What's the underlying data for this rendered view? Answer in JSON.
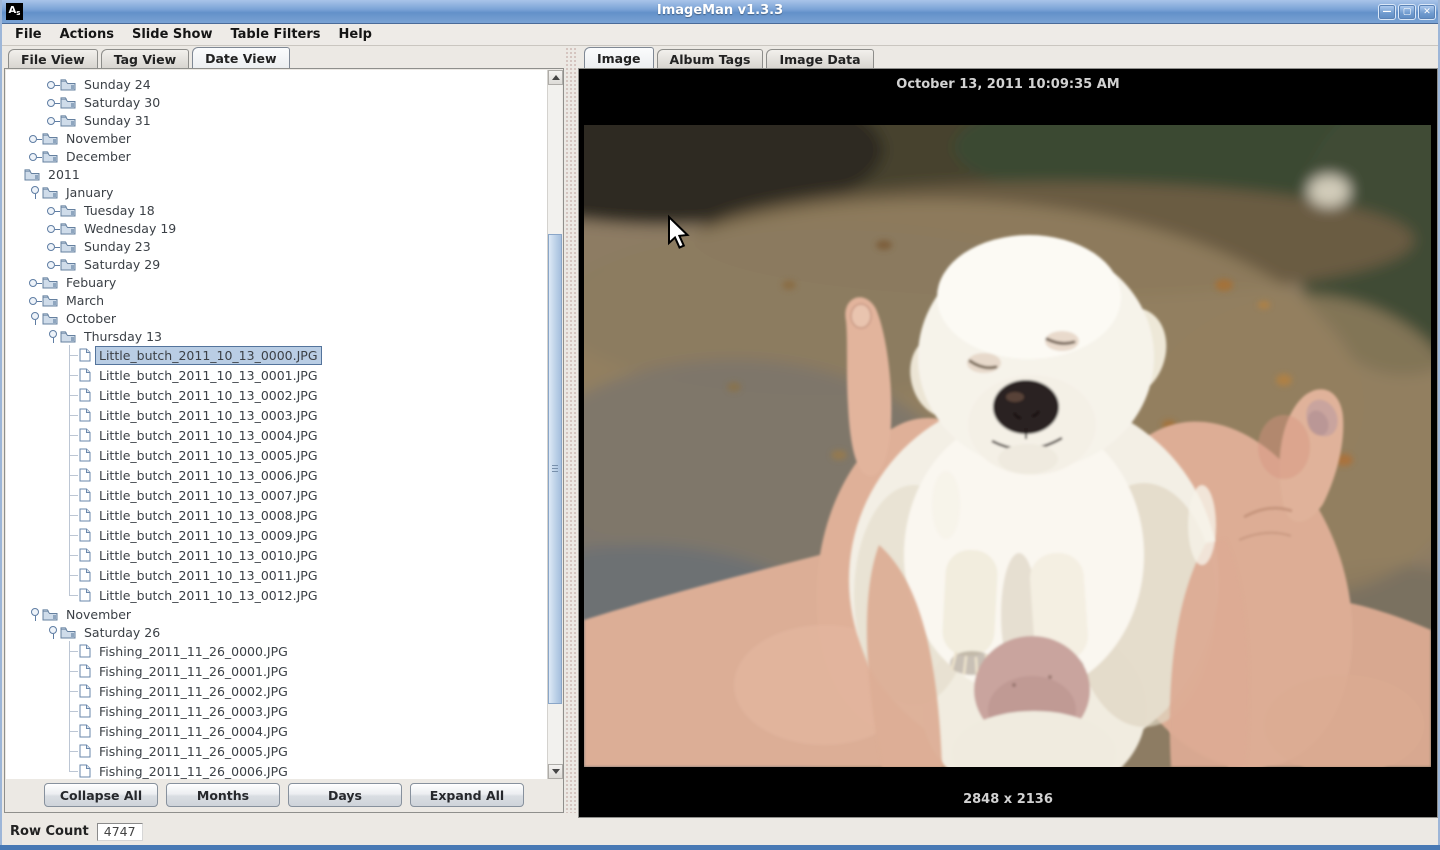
{
  "window": {
    "title": "ImageMan v1.3.3",
    "icon_text": "A",
    "icon_sub": "s",
    "controls": [
      {
        "name": "minimize",
        "glyph": "—"
      },
      {
        "name": "maximize",
        "glyph": "▢"
      },
      {
        "name": "close",
        "glyph": "✕"
      }
    ]
  },
  "menu": {
    "items": [
      "File",
      "Actions",
      "Slide Show",
      "Table Filters",
      "Help"
    ]
  },
  "left_panel": {
    "tabs": [
      {
        "label": "File View",
        "selected": false
      },
      {
        "label": "Tag View",
        "selected": false
      },
      {
        "label": "Date View",
        "selected": true
      }
    ],
    "tree": {
      "rows": [
        {
          "level": 2,
          "handle": "collapsed",
          "type": "folder",
          "label": "Sunday 24"
        },
        {
          "level": 2,
          "handle": "collapsed",
          "type": "folder",
          "label": "Saturday 30"
        },
        {
          "level": 2,
          "handle": "collapsed",
          "type": "folder",
          "label": "Sunday 31"
        },
        {
          "level": 1,
          "handle": "collapsed",
          "type": "folder",
          "label": "November"
        },
        {
          "level": 1,
          "handle": "collapsed",
          "type": "folder",
          "label": "December"
        },
        {
          "level": 0,
          "handle": "none",
          "type": "folder",
          "label": "2011"
        },
        {
          "level": 1,
          "handle": "expanded",
          "type": "folder",
          "label": "January"
        },
        {
          "level": 2,
          "handle": "collapsed",
          "type": "folder",
          "label": "Tuesday 18"
        },
        {
          "level": 2,
          "handle": "collapsed",
          "type": "folder",
          "label": "Wednesday 19"
        },
        {
          "level": 2,
          "handle": "collapsed",
          "type": "folder",
          "label": "Sunday 23"
        },
        {
          "level": 2,
          "handle": "collapsed",
          "type": "folder",
          "label": "Saturday 29"
        },
        {
          "level": 1,
          "handle": "collapsed",
          "type": "folder",
          "label": "Febuary"
        },
        {
          "level": 1,
          "handle": "collapsed",
          "type": "folder",
          "label": "March"
        },
        {
          "level": 1,
          "handle": "expanded",
          "type": "folder",
          "label": "October"
        },
        {
          "level": 2,
          "handle": "expanded",
          "type": "folder",
          "label": "Thursday 13"
        },
        {
          "level": 3,
          "handle": "none",
          "type": "file",
          "label": "Little_butch_2011_10_13_0000.JPG",
          "selected": true
        },
        {
          "level": 3,
          "handle": "none",
          "type": "file",
          "label": "Little_butch_2011_10_13_0001.JPG"
        },
        {
          "level": 3,
          "handle": "none",
          "type": "file",
          "label": "Little_butch_2011_10_13_0002.JPG"
        },
        {
          "level": 3,
          "handle": "none",
          "type": "file",
          "label": "Little_butch_2011_10_13_0003.JPG"
        },
        {
          "level": 3,
          "handle": "none",
          "type": "file",
          "label": "Little_butch_2011_10_13_0004.JPG"
        },
        {
          "level": 3,
          "handle": "none",
          "type": "file",
          "label": "Little_butch_2011_10_13_0005.JPG"
        },
        {
          "level": 3,
          "handle": "none",
          "type": "file",
          "label": "Little_butch_2011_10_13_0006.JPG"
        },
        {
          "level": 3,
          "handle": "none",
          "type": "file",
          "label": "Little_butch_2011_10_13_0007.JPG"
        },
        {
          "level": 3,
          "handle": "none",
          "type": "file",
          "label": "Little_butch_2011_10_13_0008.JPG"
        },
        {
          "level": 3,
          "handle": "none",
          "type": "file",
          "label": "Little_butch_2011_10_13_0009.JPG"
        },
        {
          "level": 3,
          "handle": "none",
          "type": "file",
          "label": "Little_butch_2011_10_13_0010.JPG"
        },
        {
          "level": 3,
          "handle": "none",
          "type": "file",
          "label": "Little_butch_2011_10_13_0011.JPG"
        },
        {
          "level": 3,
          "handle": "none",
          "type": "file",
          "label": "Little_butch_2011_10_13_0012.JPG",
          "last": true
        },
        {
          "level": 1,
          "handle": "expanded",
          "type": "folder",
          "label": "November"
        },
        {
          "level": 2,
          "handle": "expanded",
          "type": "folder",
          "label": "Saturday 26"
        },
        {
          "level": 3,
          "handle": "none",
          "type": "file",
          "label": "Fishing_2011_11_26_0000.JPG"
        },
        {
          "level": 3,
          "handle": "none",
          "type": "file",
          "label": "Fishing_2011_11_26_0001.JPG"
        },
        {
          "level": 3,
          "handle": "none",
          "type": "file",
          "label": "Fishing_2011_11_26_0002.JPG"
        },
        {
          "level": 3,
          "handle": "none",
          "type": "file",
          "label": "Fishing_2011_11_26_0003.JPG"
        },
        {
          "level": 3,
          "handle": "none",
          "type": "file",
          "label": "Fishing_2011_11_26_0004.JPG"
        },
        {
          "level": 3,
          "handle": "none",
          "type": "file",
          "label": "Fishing_2011_11_26_0005.JPG"
        },
        {
          "level": 3,
          "handle": "none",
          "type": "file",
          "label": "Fishing_2011_11_26_0006.JPG",
          "last": true
        }
      ]
    },
    "buttons": [
      "Collapse All",
      "Months",
      "Days",
      "Expand All"
    ]
  },
  "right_panel": {
    "tabs": [
      {
        "label": "Image",
        "selected": true
      },
      {
        "label": "Album Tags",
        "selected": false
      },
      {
        "label": "Image Data",
        "selected": false
      }
    ],
    "image_view": {
      "timestamp": "October 13, 2011 10:09:35 AM",
      "dimensions": "2848 x 2136"
    }
  },
  "status_bar": {
    "label": "Row Count",
    "value": "4747"
  },
  "colors": {
    "titlebar_blue": "#6f9ace",
    "selection_blue": "#b9cde4",
    "frame_blue": "#4879b4"
  }
}
